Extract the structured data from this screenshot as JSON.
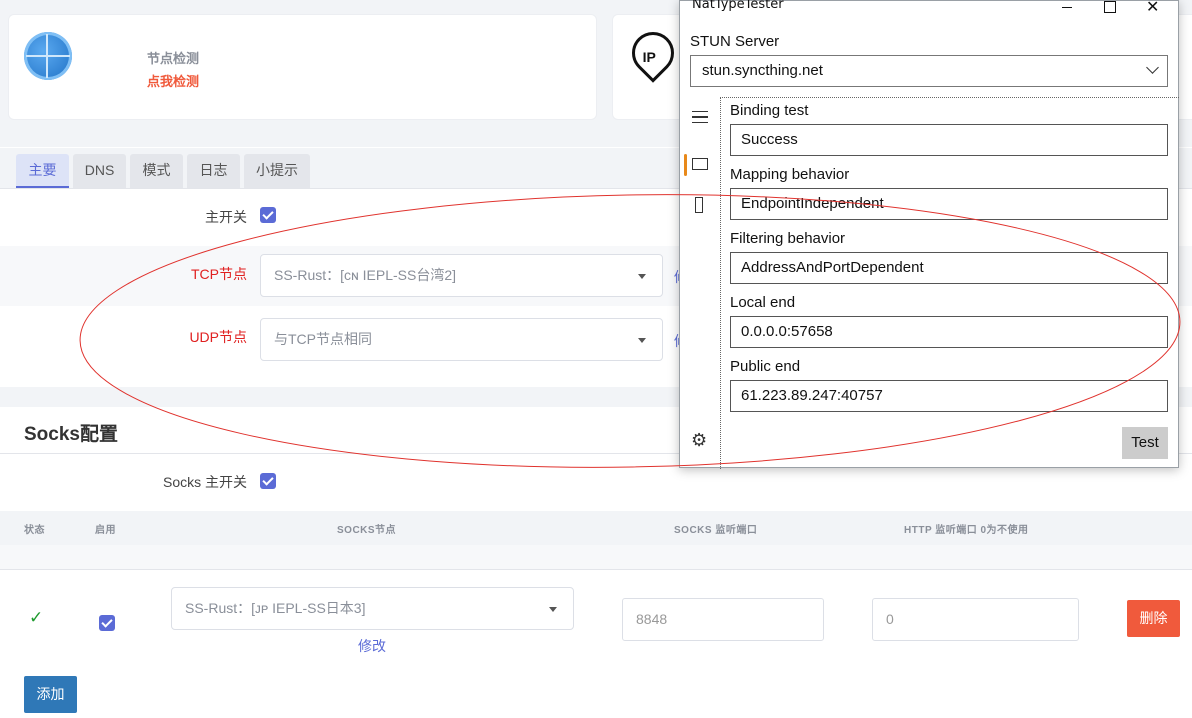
{
  "top_cards": {
    "node_check_title": "节点检测",
    "node_check_link": "点我检测",
    "ip_badge": "IP"
  },
  "tabs": [
    {
      "label": "主要",
      "active": true
    },
    {
      "label": "DNS",
      "active": false
    },
    {
      "label": "模式",
      "active": false
    },
    {
      "label": "日志",
      "active": false
    },
    {
      "label": "小提示",
      "active": false
    }
  ],
  "main": {
    "master_switch_label": "主开关",
    "master_switch_checked": true,
    "tcp_label": "TCP节点",
    "tcp_value": "SS-Rust：[ᴄɴ IEPL-SS台湾2]",
    "udp_label": "UDP节点",
    "udp_value": "与TCP节点相同",
    "side_link_fragment": "修"
  },
  "socks": {
    "title": "Socks配置",
    "switch_label": "Socks 主开关",
    "switch_checked": true,
    "columns": [
      "状态",
      "启用",
      "SOCKS节点",
      "SOCKS 监听端口",
      "HTTP 监听端口 0为不使用"
    ],
    "row": {
      "status": "✓",
      "enabled": true,
      "node": "SS-Rust：[ᴊᴘ IEPL-SS日本3]",
      "edit_link": "修改",
      "socks_port": "8848",
      "http_port": "0",
      "delete_label": "删除"
    },
    "add_label": "添加"
  },
  "nat_window": {
    "title": "NatTypeTester",
    "stun_label": "STUN Server",
    "stun_value": "stun.syncthing.net",
    "fields": [
      {
        "label": "Binding test",
        "value": "Success"
      },
      {
        "label": "Mapping behavior",
        "value": "EndpointIndependent"
      },
      {
        "label": "Filtering behavior",
        "value": "AddressAndPortDependent"
      },
      {
        "label": "Local end",
        "value": "0.0.0.0:57658"
      },
      {
        "label": "Public end",
        "value": "61.223.89.247:40757"
      }
    ],
    "test_label": "Test",
    "accent": "#e8891a"
  },
  "colors": {
    "primary": "#5b6bd6",
    "danger": "#f05a3c",
    "add_button": "#2f78b7",
    "annotation": "#e0322d"
  }
}
